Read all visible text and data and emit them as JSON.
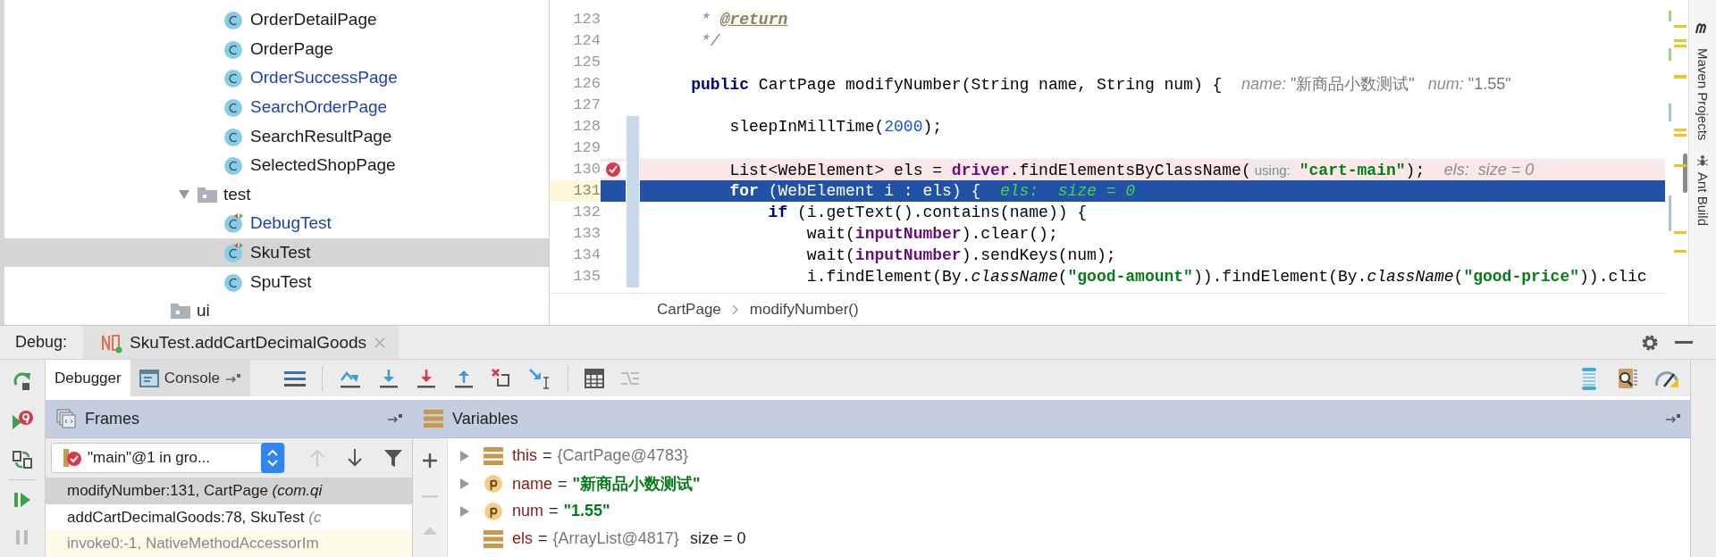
{
  "tree": [
    {
      "kind": "group",
      "children": [
        {
          "kind": "group",
          "children": [
            {
              "kind": "class",
              "label": "OrderDetailPage",
              "modified": false,
              "selected": false
            },
            {
              "kind": "class",
              "label": "OrderPage",
              "modified": false,
              "selected": false
            },
            {
              "kind": "class",
              "label": "OrderSuccessPage",
              "modified": true,
              "selected": false
            },
            {
              "kind": "class",
              "label": "SearchOrderPage",
              "modified": true,
              "selected": false
            },
            {
              "kind": "class",
              "label": "SearchResultPage",
              "modified": false,
              "selected": false
            },
            {
              "kind": "class",
              "label": "SelectedShopPage",
              "modified": false,
              "selected": false
            }
          ]
        },
        {
          "kind": "folder",
          "label": "test",
          "expanded": true,
          "selected": false,
          "children": [
            {
              "kind": "test_class",
              "label": "DebugTest",
              "modified": true,
              "selected": false
            },
            {
              "kind": "test_class",
              "label": "SkuTest",
              "modified": false,
              "selected": true
            },
            {
              "kind": "class",
              "label": "SpuTest",
              "modified": false,
              "selected": false
            }
          ]
        }
      ]
    },
    {
      "kind": "folder",
      "label": "ui",
      "selected": false
    }
  ],
  "editor": {
    "lines": [
      {
        "number": "123",
        "breakpoint": false,
        "execution_point": false,
        "changed": false,
        "tokens": [
          {
            "kind": "doc",
            "text": "     * "
          },
          {
            "kind": "doctag",
            "text": "@return"
          }
        ]
      },
      {
        "number": "124",
        "breakpoint": false,
        "execution_point": false,
        "changed": false,
        "tokens": [
          {
            "kind": "doc",
            "text": "     */"
          }
        ]
      },
      {
        "number": "125",
        "breakpoint": false,
        "execution_point": false,
        "changed": false
      },
      {
        "number": "126",
        "breakpoint": false,
        "execution_point": false,
        "changed": false,
        "tokens": [
          {
            "kind": "kw",
            "text": "    public"
          },
          {
            "kind": "plain",
            "text": " CartPage modifyNumber(String name, String num) {  "
          },
          {
            "kind": "hint",
            "text": "name: "
          },
          {
            "kind": "hintval",
            "text": "\"新商品小数测试\""
          },
          {
            "kind": "hint",
            "text": "   num: "
          },
          {
            "kind": "hintval",
            "text": "\"1.55\""
          }
        ]
      },
      {
        "number": "127",
        "breakpoint": false,
        "execution_point": false,
        "changed": false
      },
      {
        "number": "128",
        "breakpoint": false,
        "execution_point": false,
        "changed": true,
        "tokens": [
          {
            "kind": "plain",
            "text": "        sleepInMillTime("
          },
          {
            "kind": "num",
            "text": "2000"
          },
          {
            "kind": "plain",
            "text": ");"
          }
        ]
      },
      {
        "number": "129",
        "breakpoint": false,
        "execution_point": false,
        "changed": true
      },
      {
        "number": "130",
        "breakpoint": true,
        "execution_point": false,
        "changed": true,
        "tokens": [
          {
            "kind": "plain",
            "text": "        List<WebElement> els = "
          },
          {
            "kind": "field",
            "text": "driver"
          },
          {
            "kind": "plain",
            "text": ".findElementsByClassName("
          },
          {
            "kind": "hintlabel",
            "text": "using:"
          },
          {
            "kind": "str",
            "text": "\"cart-main\""
          },
          {
            "kind": "plain",
            "text": ");  "
          },
          {
            "kind": "hint",
            "text": "els:  size = 0"
          }
        ]
      },
      {
        "number": "131",
        "breakpoint": false,
        "execution_point": true,
        "changed": true,
        "tokens": [
          {
            "kind": "kw",
            "text": "        for"
          },
          {
            "kind": "plain",
            "text": " (WebElement i : els) {  "
          },
          {
            "kind": "hint",
            "text": "els:  size = 0"
          }
        ]
      },
      {
        "number": "132",
        "breakpoint": false,
        "execution_point": false,
        "changed": true,
        "tokens": [
          {
            "kind": "kw",
            "text": "            if"
          },
          {
            "kind": "plain",
            "text": " (i.getText().contains(name)) {"
          }
        ]
      },
      {
        "number": "133",
        "breakpoint": false,
        "execution_point": false,
        "changed": true,
        "tokens": [
          {
            "kind": "plain",
            "text": "                wait("
          },
          {
            "kind": "field",
            "text": "inputNumber"
          },
          {
            "kind": "plain",
            "text": ").clear();"
          }
        ]
      },
      {
        "number": "134",
        "breakpoint": false,
        "execution_point": false,
        "changed": true,
        "tokens": [
          {
            "kind": "plain",
            "text": "                wait("
          },
          {
            "kind": "field",
            "text": "inputNumber"
          },
          {
            "kind": "plain",
            "text": ").sendKeys(num);"
          }
        ]
      },
      {
        "number": "135",
        "breakpoint": false,
        "execution_point": false,
        "changed": true,
        "tokens": [
          {
            "kind": "plain",
            "text": "                i.findElement(By."
          },
          {
            "kind": "static",
            "text": "className"
          },
          {
            "kind": "plain",
            "text": "("
          },
          {
            "kind": "str",
            "text": "\"good-amount\""
          },
          {
            "kind": "plain",
            "text": ")).findElement(By."
          },
          {
            "kind": "static",
            "text": "className"
          },
          {
            "kind": "plain",
            "text": "("
          },
          {
            "kind": "str",
            "text": "\"good-price\""
          },
          {
            "kind": "plain",
            "text": ")).clic"
          }
        ]
      }
    ],
    "breadcrumb": [
      "CartPage",
      "modifyNumber()"
    ]
  },
  "side_tools": [
    {
      "label": "Maven Projects"
    },
    {
      "label": "Ant Build"
    }
  ],
  "debug": {
    "label": "Debug:",
    "session_tab": "SkuTest.addCartDecimalGoods",
    "tabs": [
      {
        "label": "Debugger",
        "selected": true
      },
      {
        "label": "Console",
        "selected": false
      }
    ],
    "frames": {
      "title": "Frames",
      "thread": "\"main\"@1 in gro...",
      "rows": [
        {
          "text": "modifyNumber:131, CartPage *(com.qi*",
          "kind": "app",
          "selected": true
        },
        {
          "text": "addCartDecimalGoods:78, SkuTest *(c*",
          "kind": "app",
          "selected": false
        },
        {
          "text": "invoke0:-1, NativeMethodAccessorIm",
          "kind": "library",
          "selected": false
        }
      ]
    },
    "variables": {
      "title": "Variables",
      "rows": [
        {
          "kind": "field",
          "name": "this",
          "operator": "=",
          "value": {
            "kind": "object",
            "text": "{CartPage@4783}"
          },
          "expandable": true
        },
        {
          "kind": "param",
          "name": "name",
          "operator": "=",
          "value": {
            "kind": "string",
            "text": "\"新商品小数测试\""
          },
          "expandable": true
        },
        {
          "kind": "param",
          "name": "num",
          "operator": "=",
          "value": {
            "kind": "string",
            "text": "\"1.55\""
          },
          "expandable": true
        },
        {
          "kind": "field",
          "name": "els",
          "operator": "=",
          "value": {
            "kind": "object",
            "text": "{ArrayList@4817}"
          },
          "extra": "size = 0",
          "expandable": false
        }
      ]
    }
  }
}
